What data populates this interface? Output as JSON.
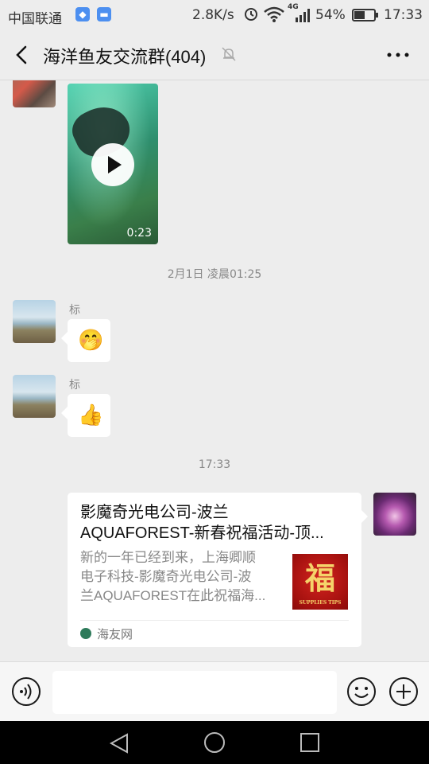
{
  "status_bar": {
    "carrier": "中国联通",
    "net_speed": "2.8K/s",
    "network_type": "4G",
    "battery_percent": "54%",
    "battery_level": 0.54,
    "time": "17:33",
    "icons": [
      "app-notification-icon",
      "message-notification-icon",
      "alarm-icon",
      "wifi-icon",
      "signal-icon",
      "battery-icon"
    ]
  },
  "header": {
    "title": "海洋鱼友交流群(404)",
    "icons": [
      "back-arrow-icon",
      "mute-bell-icon",
      "more-dots-icon"
    ]
  },
  "messages": [
    {
      "type": "video",
      "direction": "incoming",
      "duration": "0:23"
    },
    {
      "type": "timestamp",
      "text": "2月1日 凌晨01:25"
    },
    {
      "type": "emoji",
      "direction": "incoming",
      "sender": "标",
      "emoji": "🤭"
    },
    {
      "type": "emoji",
      "direction": "incoming",
      "sender": "标",
      "emoji": "👍"
    },
    {
      "type": "timestamp",
      "text": "17:33"
    },
    {
      "type": "link",
      "direction": "outgoing",
      "title_line1": "影魔奇光电公司-波兰",
      "title_line2": "AQUAFOREST-新春祝福活动-顶...",
      "desc_line1": "新的一年已经到来，上海卿顺",
      "desc_line2": "电子科技-影魔奇光电公司-波",
      "desc_line3": "兰AQUAFOREST在此祝福海...",
      "thumb_char": "福",
      "thumb_caption": "SUPPLIES TIPS",
      "source": "海友网"
    }
  ],
  "input_bar": {
    "placeholder": "",
    "icons": [
      "voice-icon",
      "emoji-face-icon",
      "plus-icon"
    ]
  },
  "nav_bar": {
    "icons": [
      "nav-back-icon",
      "nav-home-icon",
      "nav-recent-icon"
    ]
  },
  "colors": {
    "background": "#ededed",
    "bubble": "#ffffff",
    "text_secondary": "#888888"
  }
}
